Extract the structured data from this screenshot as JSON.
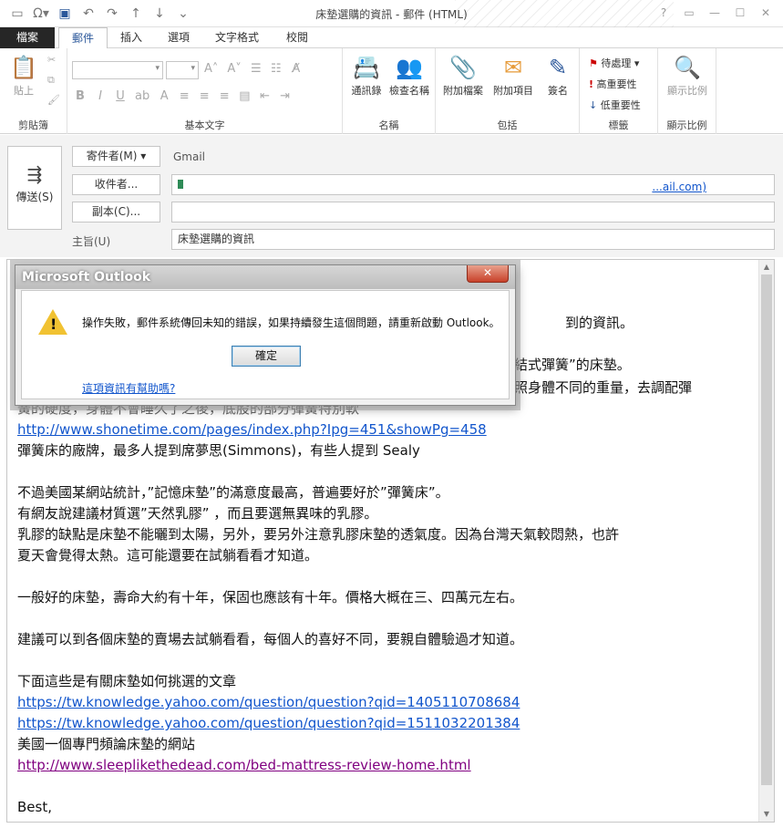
{
  "window": {
    "title": "床墊選購的資訊 - 郵件 (HTML)",
    "qat": [
      "window-icon",
      "help-dropdown-icon",
      "save-icon",
      "undo-icon",
      "redo-icon",
      "up-icon",
      "down-icon",
      "customize-icon"
    ]
  },
  "tabs": [
    "檔案",
    "郵件",
    "插入",
    "選項",
    "文字格式",
    "校閱"
  ],
  "ribbon": {
    "clipboard": {
      "label": "剪貼簿",
      "paste": "貼上"
    },
    "basic_text": {
      "label": "基本文字"
    },
    "names": {
      "label": "名稱",
      "address_book": "通訊錄",
      "check_names": "檢查名稱"
    },
    "include": {
      "label": "包括",
      "attach_file": "附加檔案",
      "attach_item": "附加項目",
      "signature": "簽名"
    },
    "tags": {
      "label": "標籤",
      "follow_up": "待處理",
      "high_importance": "高重要性",
      "low_importance": "低重要性"
    },
    "zoom": {
      "label": "顯示比例",
      "zoom": "顯示比例"
    }
  },
  "header": {
    "send": "傳送(S)",
    "from_button": "寄件者(M) ▾",
    "from_value": "Gmail",
    "to_button": "收件者...",
    "to_value_tail": "...ail.com)",
    "cc_button": "副本(C)...",
    "subject_label": "主旨(U)",
    "subject_value": "床墊選購的資訊"
  },
  "body": {
    "visible_fragments": {
      "line1_tail": "到的資訊。",
      "line2_tail": "結式彈簧”的床墊。",
      "line3_tail": "照身體不同的重量，去調配彈",
      "line4": "簧的硬度，身體不會睡久了之後，底股的部分彈簧特別軟"
    },
    "lines": [
      {
        "text": "http://www.shonetime.com/pages/index.php?Ipg=451&showPg=458",
        "link": true
      },
      {
        "text": "彈簧床的廠牌，最多人提到席夢思(Simmons)，有些人提到 Sealy"
      },
      {
        "text": ""
      },
      {
        "text": "不過美國某網站統計，”記憶床墊”的滿意度最高，普遍要好於”彈簧床”。"
      },
      {
        "text": "有網友說建議材質選”天然乳膠” ，而且要選無異味的乳膠。"
      },
      {
        "text": "乳膠的缺點是床墊不能曬到太陽，另外，要另外注意乳膠床墊的透氣度。因為台灣天氣較悶熱，也許"
      },
      {
        "text": "夏天會覺得太熱。這可能還要在試躺看看才知道。"
      },
      {
        "text": ""
      },
      {
        "text": "一般好的床墊，壽命大約有十年，保固也應該有十年。價格大概在三、四萬元左右。"
      },
      {
        "text": ""
      },
      {
        "text": "建議可以到各個床墊的賣場去試躺看看，每個人的喜好不同，要親自體驗過才知道。"
      },
      {
        "text": ""
      },
      {
        "text": "下面這些是有關床墊如何挑選的文章"
      },
      {
        "text": "https://tw.knowledge.yahoo.com/question/question?qid=1405110708684",
        "link": true
      },
      {
        "text": "https://tw.knowledge.yahoo.com/question/question?qid=1511032201384",
        "link": true
      },
      {
        "text": "美國一個專門頻論床墊的網站"
      },
      {
        "text": "http://www.sleeplikethedead.com/bed-mattress-review-home.html",
        "link": true,
        "visited": true
      },
      {
        "text": ""
      },
      {
        "text": "Best,"
      }
    ]
  },
  "dialog": {
    "title": "Microsoft Outlook",
    "close": "✕",
    "message": "操作失敗，郵件系統傳回未知的錯誤，如果持續發生這個問題，請重新啟動 Outlook。",
    "ok": "確定",
    "help_link": "這項資訊有幫助嗎?"
  },
  "colors": {
    "accent": "#2b579a",
    "link": "#1155cc",
    "visited": "#800080"
  }
}
